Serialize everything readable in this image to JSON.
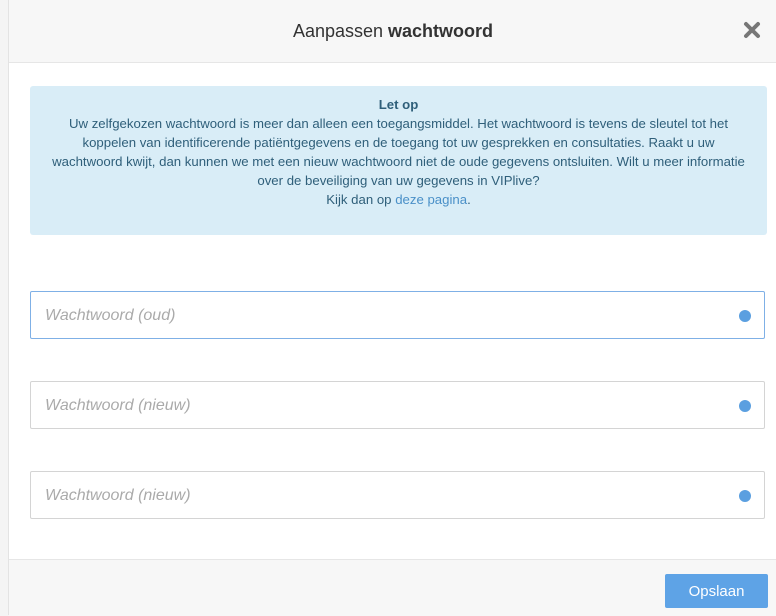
{
  "header": {
    "title_prefix": "Aanpassen",
    "title_bold": "wachtwoord",
    "close_icon": "close-icon"
  },
  "alert": {
    "title": "Let op",
    "body": "Uw zelfgekozen wachtwoord is meer dan alleen een toegangsmiddel. Het wachtwoord is tevens de sleutel tot het koppelen van identificerende patiëntgegevens en de toegang tot uw gesprekken en consultaties. Raakt u uw wachtwoord kwijt, dan kunnen we met een nieuw wachtwoord niet de oude gegevens ontsluiten. Wilt u meer informatie over de beveiliging van uw gegevens in VIPlive?",
    "link_prefix": "Kijk dan op ",
    "link_text": "deze pagina",
    "link_suffix": "."
  },
  "form": {
    "old_password_placeholder": "Wachtwoord (oud)",
    "new_password_placeholder": "Wachtwoord (nieuw)",
    "confirm_password_placeholder": "Wachtwoord (nieuw)",
    "indicator_color": "#5b9fe0"
  },
  "footer": {
    "save_label": "Opslaan",
    "accent": "#5ea3e6"
  }
}
